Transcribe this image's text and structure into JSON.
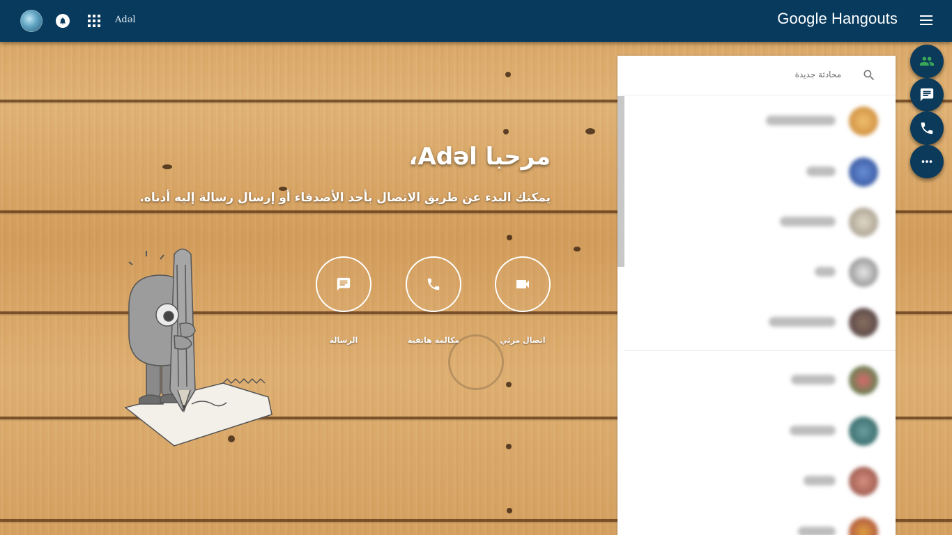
{
  "colors": {
    "topbar": "#073a5d",
    "fab": "#0b3a5a",
    "people_icon": "#3aa757",
    "panel": "#ffffff"
  },
  "header": {
    "user_name": "Adəl",
    "brand": "Google Hangouts",
    "icons": [
      "avatar",
      "bell-icon",
      "apps-grid-icon",
      "hamburger-menu-icon"
    ]
  },
  "welcome": {
    "title": "مرحبا Adəl،",
    "subtitle": "يمكنك البدء عن طريق الاتصال بأحد الأصدقاء أو إرسال رسالة إليه أدناه."
  },
  "actions": [
    {
      "id": "video",
      "label": "اتصال مرئي",
      "icon": "videocam-icon"
    },
    {
      "id": "phone",
      "label": "مكالمة هاتفية",
      "icon": "phone-icon"
    },
    {
      "id": "message",
      "label": "الرسالة",
      "icon": "message-icon"
    }
  ],
  "panel": {
    "search_placeholder": "محادثة جديدة",
    "search_icon": "search-icon"
  },
  "fabs": [
    {
      "icon": "people-icon"
    },
    {
      "icon": "chat-icon"
    },
    {
      "icon": "phone-icon"
    },
    {
      "icon": "more-horiz-icon"
    }
  ]
}
